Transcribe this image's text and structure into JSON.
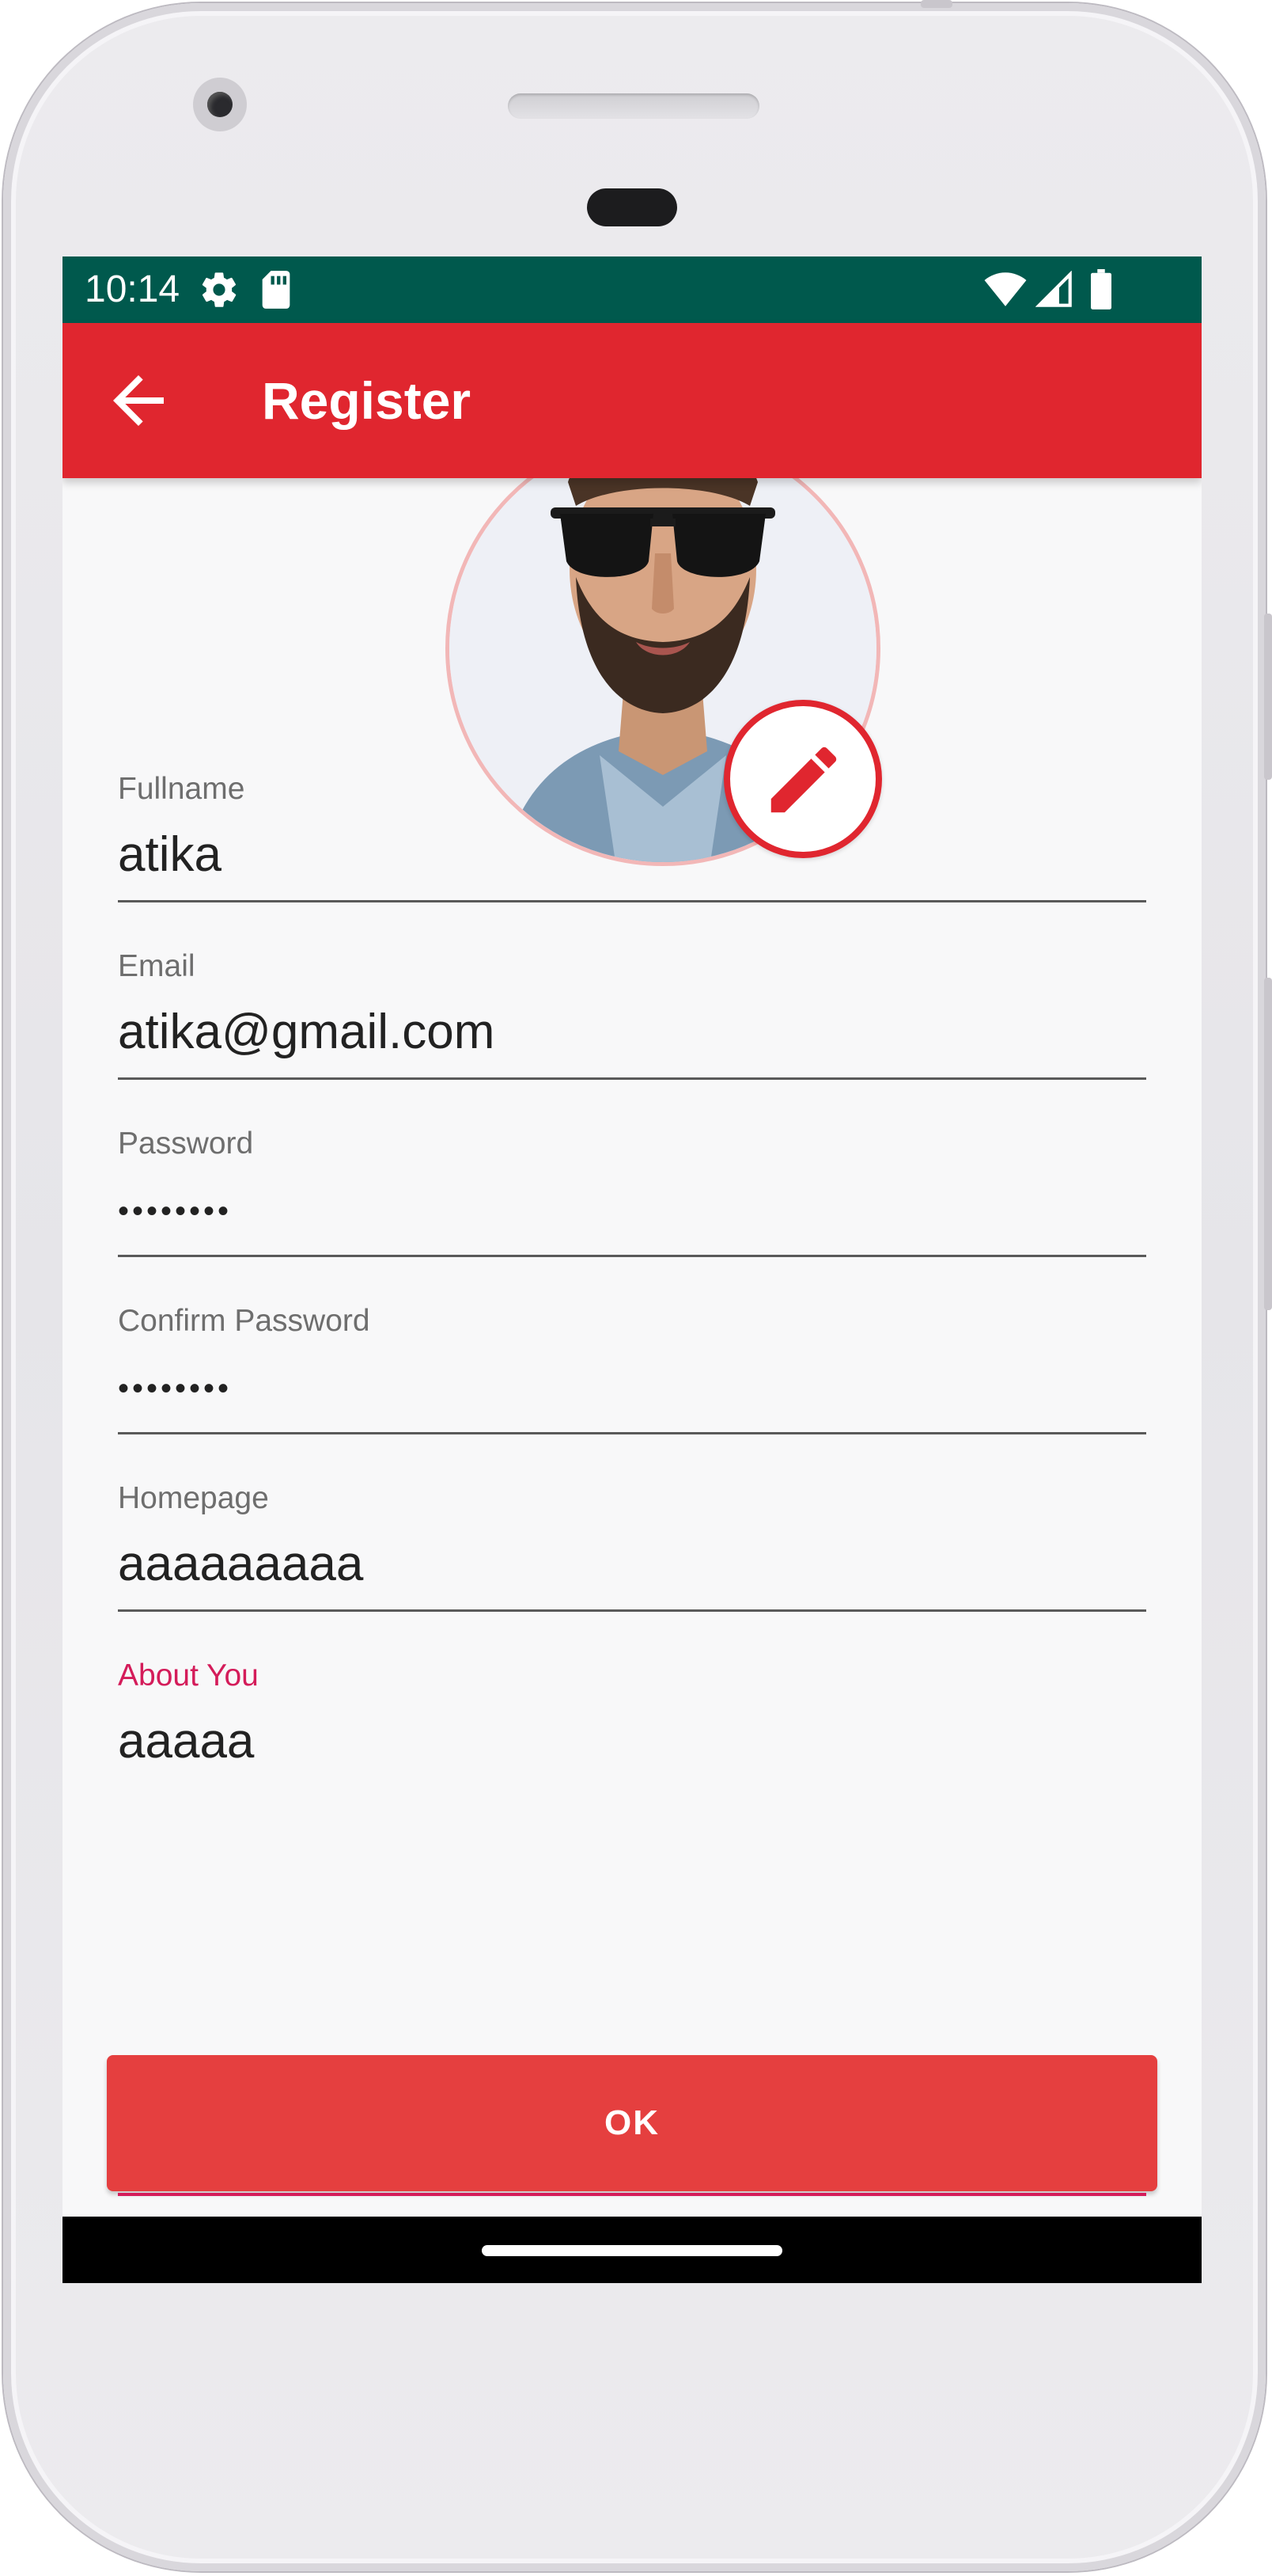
{
  "status_bar": {
    "time": "10:14",
    "icons": [
      "settings-gear-icon",
      "sd-card-icon",
      "wifi-icon",
      "cellular-signal-icon",
      "battery-icon"
    ],
    "background_color": "#00594d"
  },
  "app_bar": {
    "title": "Register",
    "back_icon": "arrow-back-icon",
    "background_color": "#e0262f"
  },
  "avatar": {
    "edit_icon": "pencil-icon",
    "accent_color": "#e0262f"
  },
  "form": {
    "fullname": {
      "label": "Fullname",
      "value": "atika"
    },
    "email": {
      "label": "Email",
      "value": "atika@gmail.com"
    },
    "password": {
      "label": "Password",
      "value": "••••••••"
    },
    "confirm_password": {
      "label": "Confirm Password",
      "value": "••••••••"
    },
    "homepage": {
      "label": "Homepage",
      "value": "aaaaaaaaa"
    },
    "about_you": {
      "label": "About You",
      "value": "aaaaa",
      "focused": true
    }
  },
  "actions": {
    "ok_label": "OK",
    "ok_color": "#e53f3f"
  },
  "colors": {
    "focus_accent": "#d41c5a",
    "screen_background": "#f8f8f9"
  }
}
